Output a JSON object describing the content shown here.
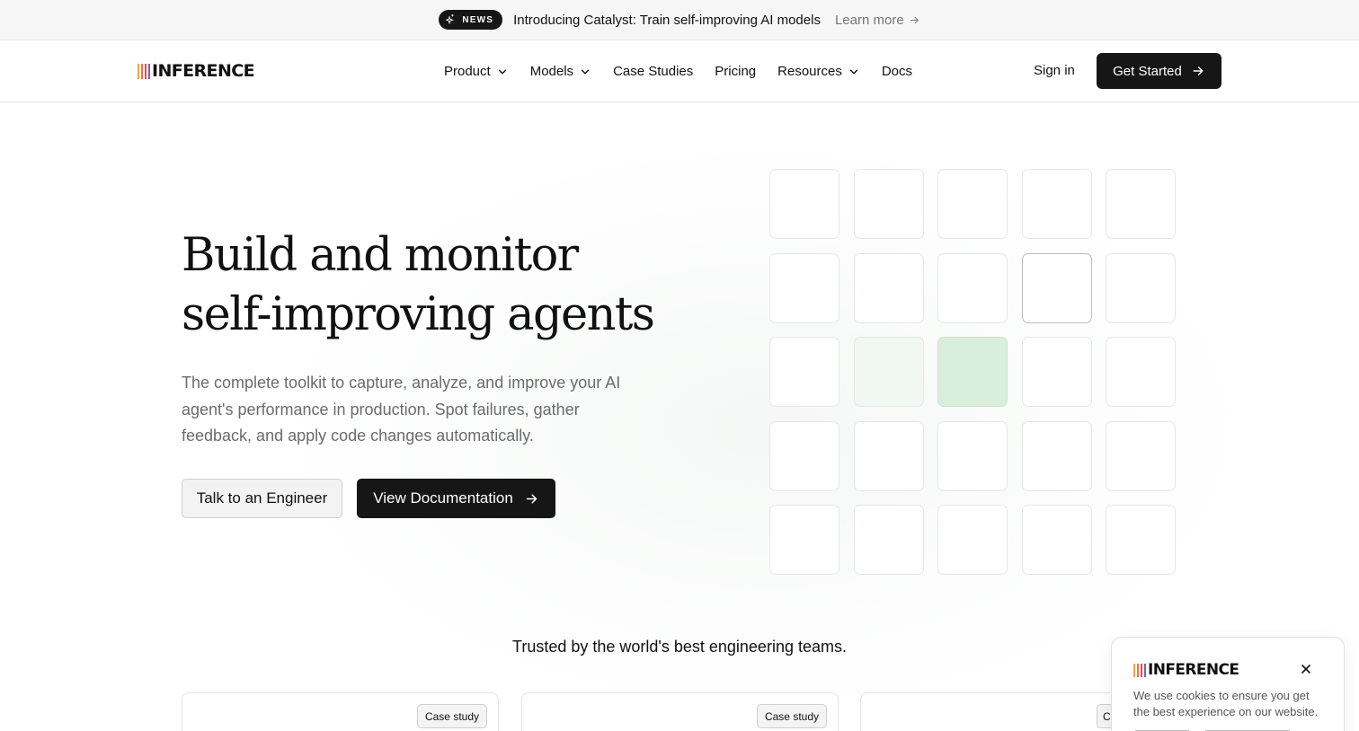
{
  "announcement": {
    "badge": "NEWS",
    "text": "Introducing Catalyst: Train self-improving AI models",
    "link": "Learn more"
  },
  "brand": {
    "name": "INFERENCE",
    "bar_colors": [
      "#f2a541",
      "#e8784a",
      "#d94f5c",
      "#7a5cc9"
    ]
  },
  "nav": {
    "items": [
      {
        "label": "Product",
        "icon": "chevron-down-icon"
      },
      {
        "label": "Models",
        "icon": "chevron-down-icon"
      },
      {
        "label": "Case Studies"
      },
      {
        "label": "Pricing"
      },
      {
        "label": "Resources",
        "icon": "chevron-down-icon"
      },
      {
        "label": "Docs"
      }
    ],
    "sign_in": "Sign in",
    "get_started": "Get Started"
  },
  "hero": {
    "title_line1": "Build and monitor",
    "title_line2": "self-improving agents",
    "subtitle": "The complete toolkit to capture, analyze, and improve your AI agent's performance in production. Spot failures, gather feedback, and apply code changes automatically.",
    "secondary_button": "Talk to an Engineer",
    "primary_button": "View Documentation"
  },
  "tile_grid": {
    "rows": 5,
    "cols": 5,
    "highlighted": [
      {
        "row": 2,
        "col": 4,
        "state": "outlined"
      },
      {
        "row": 3,
        "col": 2,
        "state": "light-green"
      },
      {
        "row": 3,
        "col": 3,
        "state": "green"
      }
    ],
    "colors": {
      "light_green": "#f1f7f2",
      "green": "#d9eedd"
    }
  },
  "trusted": {
    "heading": "Trusted by the world's best engineering teams.",
    "cards": [
      {
        "badge": "Case study"
      },
      {
        "badge": "Case study"
      },
      {
        "badge": "C"
      }
    ]
  },
  "cookie": {
    "brand": "INFERENCE",
    "text": "We use cookies to ensure you get the best experience on our website."
  },
  "colors": {
    "primary_button": "#161616",
    "accent_green": "#d9eedd"
  }
}
